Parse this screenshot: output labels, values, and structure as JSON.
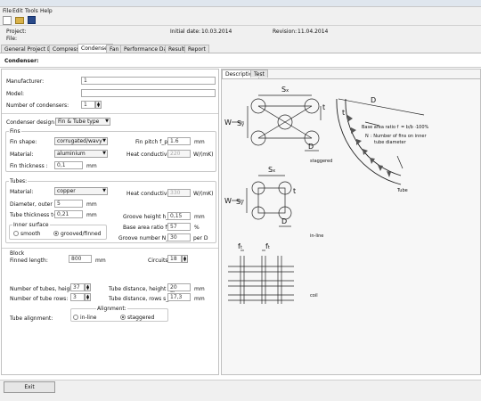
{
  "menu": {
    "file": "File",
    "edit": "Edit",
    "tools": "Tools",
    "help": "Help"
  },
  "project": {
    "project_label": "Project:",
    "file_label": "File:",
    "initial_date_label": "Initial date:",
    "initial_date": "10.03.2014",
    "revision_label": "Revision:",
    "revision": "11.04.2014"
  },
  "tabs": [
    "General Project Data",
    "Compressor",
    "Condenser",
    "Fan",
    "Performance Data",
    "Results",
    "Report"
  ],
  "active_tab": "Condenser",
  "section_title": "Condenser:",
  "general": {
    "manufacturer_label": "Manufacturer:",
    "manufacturer_value": "1",
    "model_label": "Model:",
    "model_value": "",
    "num_condensers_label": "Number of condensers:",
    "num_condensers_value": "1"
  },
  "design": {
    "label": "Condenser design",
    "value": "Fin & Tube type"
  },
  "fins": {
    "title": "Fins",
    "shape_label": "Fin shape:",
    "shape_value": "corrugated/wavy",
    "pitch_label": "Fin pitch f_p=",
    "pitch_value": "1.6",
    "pitch_unit": "mm",
    "material_label": "Material:",
    "material_value": "aluminium",
    "heat_cond_label": "Heat conductivity:",
    "heat_cond_value": "220",
    "heat_cond_unit": "W/(mK)",
    "thickness_label": "Fin thickness :",
    "thickness_value": "0,1",
    "thickness_unit": "mm"
  },
  "tubes": {
    "title": "Tubes:",
    "material_label": "Material:",
    "material_value": "copper",
    "heat_cond_label": "Heat conductivity:",
    "heat_cond_value": "330",
    "heat_cond_unit": "W/(mK)",
    "diameter_label": "Diameter, outer D=",
    "diameter_value": "5",
    "diameter_unit": "mm",
    "thickness_label": "Tube thickness  t=",
    "thickness_value": "0,21",
    "thickness_unit": "mm",
    "groove_height_label": "Groove height h_G=",
    "groove_height_value": "0,15",
    "groove_height_unit": "mm",
    "base_ratio_label": "Base area ratio f_G=",
    "base_ratio_value": "57",
    "base_ratio_unit": "%",
    "groove_number_label": "Groove number N_G=",
    "groove_number_value": "30",
    "groove_number_unit": "per D",
    "inner_surface_title": "Inner surface",
    "smooth_label": "smooth",
    "grooved_label": "grooved/finned"
  },
  "block": {
    "title": "Block",
    "finned_length_label": "Finned length:",
    "finned_length_value": "800",
    "finned_length_unit": "mm",
    "circuits_label": "Circuits:",
    "circuits_value": "18",
    "tubes_height_label": "Number of tubes, height:",
    "tubes_height_value": "37",
    "tube_dist_height_label": "Tube distance, height s_y=",
    "tube_dist_height_value": "20",
    "tube_dist_height_unit": "mm",
    "tube_rows_label": "Number of tube rows:",
    "tube_rows_value": "3",
    "tube_dist_rows_label": "Tube distance, rows s_x=",
    "tube_dist_rows_value": "17,3",
    "tube_dist_rows_unit": "mm",
    "alignment_label": "Tube alignment:",
    "alignment_title": "Alignment:",
    "inline_label": "in-line",
    "staggered_label": "staggered"
  },
  "right_tabs": [
    "Description",
    "Test"
  ],
  "figure": {
    "staggered": "staggered",
    "inline": "in-line",
    "coil": "coil",
    "tube": "Tube",
    "D": "D",
    "W": "W",
    "Sx": "S",
    "Sy": "S",
    "t": "t",
    "x": "x",
    "y": "y",
    "s": "s",
    "f": "f",
    "bG": "b",
    "hG": "h",
    "base_ratio_note": "Base area ratio f",
    "base_ratio_eq": "= b/b ·100%",
    "ng_note": "N",
    "ng_note2": ": Number of fins on inner",
    "ng_note3": "tube diameter"
  },
  "exit_label": "Exit"
}
